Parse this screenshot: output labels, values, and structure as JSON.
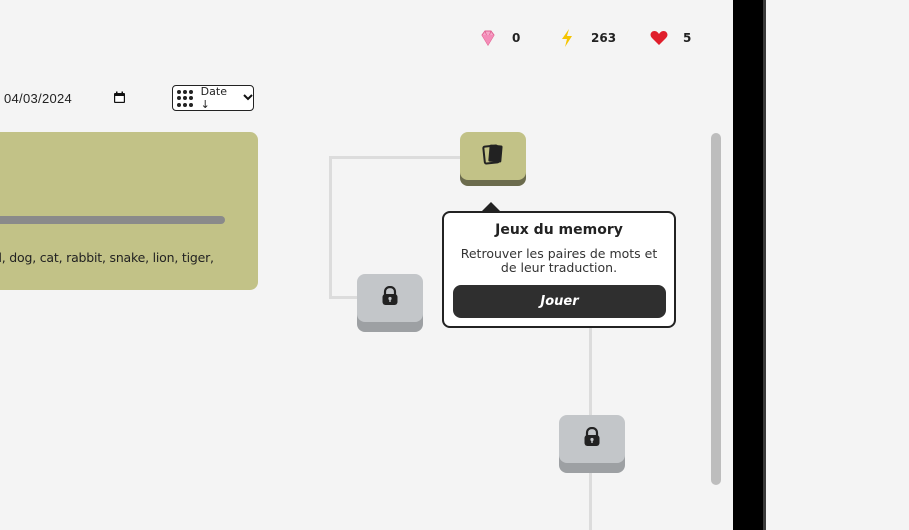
{
  "stats": {
    "gems": "0",
    "energy": "263",
    "lives": "5"
  },
  "toolbar": {
    "date_value": "04/03/2024",
    "sort_label": "Date ↓"
  },
  "card": {
    "words": "d, dog, cat, rabbit, snake, lion, tiger,"
  },
  "popup": {
    "title": "Jeux du memory",
    "description": "Retrouver les paires de mots et de leur traduction.",
    "play_label": "Jouer"
  },
  "colors": {
    "accent": "#c2c287",
    "button": "#2f2f2f",
    "locked": "#c3c6c9"
  },
  "icons": {
    "gems": "gem-icon",
    "energy": "lightning-icon",
    "lives": "heart-icon",
    "active_node": "cards-icon",
    "locked_node": "lock-icon"
  }
}
